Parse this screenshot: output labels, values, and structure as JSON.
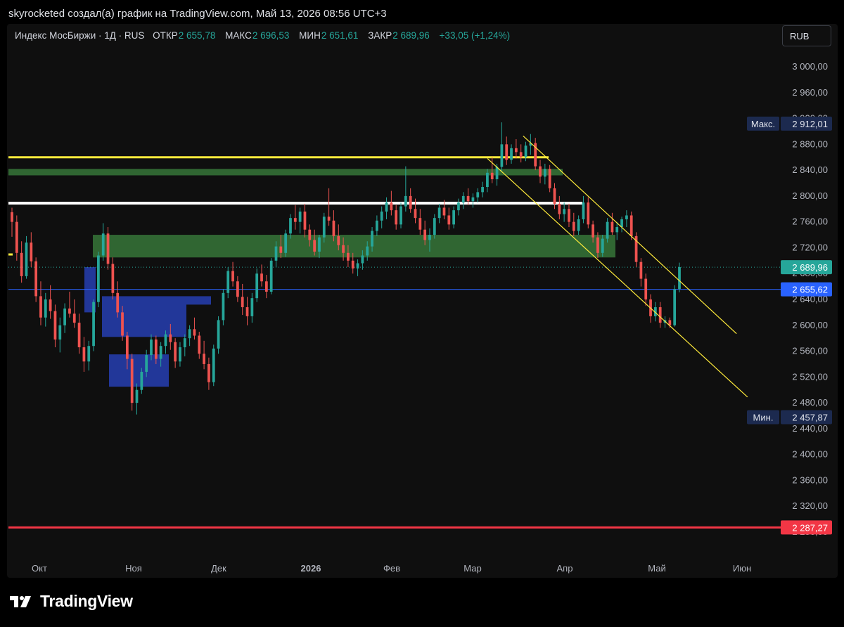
{
  "header": {
    "caption": "skyrocketed создал(а) график на TradingView.com, Май 13, 2026 08:56 UTC+3"
  },
  "legend": {
    "symbol": "Индекс МосБиржи · 1Д · RUS",
    "open_label": "ОТКР",
    "open": "2 655,78",
    "high_label": "МАКС",
    "high": "2 696,53",
    "low_label": "МИН",
    "low": "2 651,61",
    "close_label": "ЗАКР",
    "close": "2 689,96",
    "change": "+33,05 (+1,24%)"
  },
  "currency_button": "RUB",
  "brand": {
    "name": "TradingView"
  },
  "colors": {
    "up": "#26a69a",
    "down": "#ef5350",
    "yellow": "#ffeb3b",
    "support_red": "#f23645",
    "blue_line": "#2962ff"
  },
  "chart_data": {
    "type": "candlestick",
    "ylim": [
      2275,
      3015
    ],
    "y_ticks": [
      "3000,00",
      "2960,00",
      "2920,00",
      "2880,00",
      "2840,00",
      "2800,00",
      "2760,00",
      "2720,00",
      "2680,00",
      "2640,00",
      "2600,00",
      "2560,00",
      "2520,00",
      "2480,00",
      "2440,00",
      "2400,00",
      "2360,00",
      "2320,00",
      "2280,00"
    ],
    "x_ticks": [
      "Окт",
      "Ноя",
      "Дек",
      "2026",
      "Фев",
      "Мар",
      "Апр",
      "Май",
      "Июн"
    ],
    "series_ohlc_approx": [
      [
        2775,
        2782,
        2737,
        2760
      ],
      [
        2760,
        2770,
        2700,
        2712
      ],
      [
        2712,
        2730,
        2666,
        2676
      ],
      [
        2676,
        2738,
        2672,
        2728
      ],
      [
        2728,
        2744,
        2690,
        2699
      ],
      [
        2699,
        2705,
        2636,
        2645
      ],
      [
        2645,
        2668,
        2600,
        2612
      ],
      [
        2612,
        2650,
        2598,
        2640
      ],
      [
        2640,
        2662,
        2610,
        2622
      ],
      [
        2622,
        2632,
        2566,
        2578
      ],
      [
        2578,
        2612,
        2558,
        2600
      ],
      [
        2600,
        2634,
        2588,
        2626
      ],
      [
        2626,
        2652,
        2612,
        2618
      ],
      [
        2618,
        2640,
        2596,
        2604
      ],
      [
        2604,
        2618,
        2556,
        2566
      ],
      [
        2566,
        2582,
        2528,
        2544
      ],
      [
        2544,
        2576,
        2530,
        2568
      ],
      [
        2568,
        2640,
        2560,
        2636
      ],
      [
        2636,
        2714,
        2628,
        2708
      ],
      [
        2708,
        2758,
        2700,
        2742
      ],
      [
        2742,
        2752,
        2686,
        2695
      ],
      [
        2695,
        2705,
        2640,
        2650
      ],
      [
        2650,
        2668,
        2612,
        2620
      ],
      [
        2620,
        2630,
        2576,
        2584
      ],
      [
        2584,
        2590,
        2532,
        2548
      ],
      [
        2548,
        2556,
        2468,
        2480
      ],
      [
        2480,
        2510,
        2462,
        2500
      ],
      [
        2500,
        2534,
        2494,
        2528
      ],
      [
        2528,
        2562,
        2520,
        2554
      ],
      [
        2554,
        2586,
        2546,
        2578
      ],
      [
        2578,
        2584,
        2540,
        2548
      ],
      [
        2548,
        2574,
        2536,
        2568
      ],
      [
        2568,
        2592,
        2556,
        2586
      ],
      [
        2586,
        2602,
        2562,
        2574
      ],
      [
        2574,
        2580,
        2534,
        2544
      ],
      [
        2544,
        2574,
        2536,
        2566
      ],
      [
        2566,
        2586,
        2552,
        2580
      ],
      [
        2580,
        2600,
        2568,
        2594
      ],
      [
        2594,
        2612,
        2578,
        2584
      ],
      [
        2584,
        2590,
        2548,
        2556
      ],
      [
        2556,
        2576,
        2532,
        2540
      ],
      [
        2540,
        2550,
        2500,
        2512
      ],
      [
        2512,
        2570,
        2506,
        2564
      ],
      [
        2564,
        2614,
        2556,
        2608
      ],
      [
        2608,
        2656,
        2600,
        2650
      ],
      [
        2650,
        2690,
        2642,
        2684
      ],
      [
        2684,
        2698,
        2660,
        2668
      ],
      [
        2668,
        2676,
        2636,
        2644
      ],
      [
        2644,
        2664,
        2616,
        2628
      ],
      [
        2628,
        2644,
        2600,
        2614
      ],
      [
        2614,
        2650,
        2604,
        2642
      ],
      [
        2642,
        2688,
        2636,
        2680
      ],
      [
        2680,
        2694,
        2660,
        2668
      ],
      [
        2668,
        2678,
        2642,
        2652
      ],
      [
        2652,
        2704,
        2648,
        2700
      ],
      [
        2700,
        2730,
        2690,
        2722
      ],
      [
        2722,
        2740,
        2704,
        2712
      ],
      [
        2712,
        2748,
        2706,
        2742
      ],
      [
        2742,
        2772,
        2734,
        2766
      ],
      [
        2766,
        2786,
        2748,
        2760
      ],
      [
        2760,
        2782,
        2742,
        2776
      ],
      [
        2776,
        2788,
        2736,
        2748
      ],
      [
        2748,
        2756,
        2722,
        2732
      ],
      [
        2732,
        2748,
        2708,
        2714
      ],
      [
        2714,
        2740,
        2704,
        2736
      ],
      [
        2736,
        2774,
        2728,
        2768
      ],
      [
        2768,
        2812,
        2754,
        2762
      ],
      [
        2762,
        2778,
        2730,
        2738
      ],
      [
        2738,
        2756,
        2716,
        2724
      ],
      [
        2724,
        2736,
        2700,
        2712
      ],
      [
        2712,
        2724,
        2690,
        2700
      ],
      [
        2700,
        2712,
        2680,
        2688
      ],
      [
        2688,
        2702,
        2676,
        2696
      ],
      [
        2696,
        2716,
        2686,
        2708
      ],
      [
        2708,
        2730,
        2700,
        2722
      ],
      [
        2722,
        2752,
        2714,
        2746
      ],
      [
        2746,
        2770,
        2738,
        2762
      ],
      [
        2762,
        2784,
        2750,
        2776
      ],
      [
        2776,
        2798,
        2764,
        2790
      ],
      [
        2790,
        2808,
        2770,
        2778
      ],
      [
        2778,
        2786,
        2748,
        2756
      ],
      [
        2756,
        2790,
        2750,
        2784
      ],
      [
        2784,
        2846,
        2776,
        2800
      ],
      [
        2800,
        2812,
        2774,
        2780
      ],
      [
        2780,
        2796,
        2758,
        2766
      ],
      [
        2766,
        2780,
        2740,
        2748
      ],
      [
        2748,
        2762,
        2724,
        2732
      ],
      [
        2732,
        2750,
        2714,
        2740
      ],
      [
        2740,
        2772,
        2734,
        2766
      ],
      [
        2766,
        2788,
        2758,
        2782
      ],
      [
        2782,
        2794,
        2764,
        2770
      ],
      [
        2770,
        2782,
        2748,
        2756
      ],
      [
        2756,
        2784,
        2750,
        2778
      ],
      [
        2778,
        2796,
        2770,
        2790
      ],
      [
        2790,
        2806,
        2780,
        2800
      ],
      [
        2800,
        2812,
        2786,
        2792
      ],
      [
        2792,
        2804,
        2782,
        2798
      ],
      [
        2798,
        2812,
        2790,
        2806
      ],
      [
        2806,
        2822,
        2798,
        2814
      ],
      [
        2814,
        2842,
        2806,
        2836
      ],
      [
        2836,
        2860,
        2820,
        2826
      ],
      [
        2826,
        2850,
        2816,
        2845
      ],
      [
        2845,
        2914,
        2838,
        2880
      ],
      [
        2880,
        2892,
        2848,
        2856
      ],
      [
        2856,
        2880,
        2850,
        2874
      ],
      [
        2874,
        2888,
        2858,
        2868
      ],
      [
        2868,
        2880,
        2852,
        2860
      ],
      [
        2860,
        2884,
        2854,
        2878
      ],
      [
        2878,
        2896,
        2864,
        2882
      ],
      [
        2882,
        2890,
        2840,
        2846
      ],
      [
        2846,
        2856,
        2820,
        2830
      ],
      [
        2830,
        2850,
        2818,
        2842
      ],
      [
        2842,
        2848,
        2806,
        2812
      ],
      [
        2812,
        2820,
        2780,
        2788
      ],
      [
        2788,
        2800,
        2764,
        2772
      ],
      [
        2772,
        2790,
        2760,
        2780
      ],
      [
        2780,
        2788,
        2752,
        2760
      ],
      [
        2760,
        2774,
        2738,
        2746
      ],
      [
        2746,
        2770,
        2740,
        2764
      ],
      [
        2764,
        2800,
        2758,
        2790
      ],
      [
        2790,
        2798,
        2750,
        2756
      ],
      [
        2756,
        2762,
        2728,
        2736
      ],
      [
        2736,
        2744,
        2704,
        2712
      ],
      [
        2712,
        2740,
        2706,
        2734
      ],
      [
        2734,
        2766,
        2728,
        2760
      ],
      [
        2760,
        2774,
        2740,
        2744
      ],
      [
        2744,
        2760,
        2732,
        2752
      ],
      [
        2752,
        2768,
        2744,
        2764
      ],
      [
        2764,
        2778,
        2752,
        2770
      ],
      [
        2770,
        2776,
        2732,
        2738
      ],
      [
        2738,
        2744,
        2690,
        2698
      ],
      [
        2698,
        2704,
        2660,
        2672
      ],
      [
        2672,
        2680,
        2630,
        2640
      ],
      [
        2640,
        2648,
        2604,
        2614
      ],
      [
        2614,
        2636,
        2606,
        2628
      ],
      [
        2628,
        2636,
        2596,
        2604
      ],
      [
        2604,
        2614,
        2596,
        2608
      ],
      [
        2608,
        2612,
        2596,
        2600
      ],
      [
        2600,
        2662,
        2598,
        2656
      ],
      [
        2656,
        2697,
        2651,
        2690
      ]
    ],
    "zones": [
      {
        "name": "supply-zone-upper",
        "type": "green",
        "y": [
          2832,
          2842
        ]
      },
      {
        "name": "supply-zone-lower",
        "type": "green",
        "y": [
          2705,
          2740
        ]
      },
      {
        "name": "demand-zone-blue-1",
        "type": "blue",
        "y": [
          2582,
          2645
        ]
      },
      {
        "name": "demand-zone-blue-2",
        "type": "blue",
        "y": [
          2505,
          2555
        ]
      }
    ],
    "horizontal_lines": [
      {
        "name": "resistance-yellow",
        "value": 2860,
        "color": "#ffeb3b"
      },
      {
        "name": "resistance-white",
        "value": 2789,
        "color": "#ffffff"
      },
      {
        "name": "blue-level",
        "value": 2655.62,
        "color": "#2962ff"
      },
      {
        "name": "red-support",
        "value": 2287.27,
        "color": "#f23645"
      }
    ],
    "channel_lines": [
      {
        "name": "channel-upper",
        "start": [
          "2026-03-18",
          2893
        ],
        "end": [
          "2026-05-30",
          2587
        ]
      },
      {
        "name": "channel-lower",
        "start": [
          "2026-03-06",
          2858
        ],
        "end": [
          "2026-06-03",
          2489
        ]
      }
    ],
    "price_tags": {
      "max": {
        "label": "Макс.",
        "value": "2912,01"
      },
      "min": {
        "label": "Мин.",
        "value": "2457,87"
      },
      "last": {
        "value": "2689,96"
      },
      "blue": {
        "value": "2655,62"
      },
      "red": {
        "value": "2287,27"
      }
    }
  }
}
